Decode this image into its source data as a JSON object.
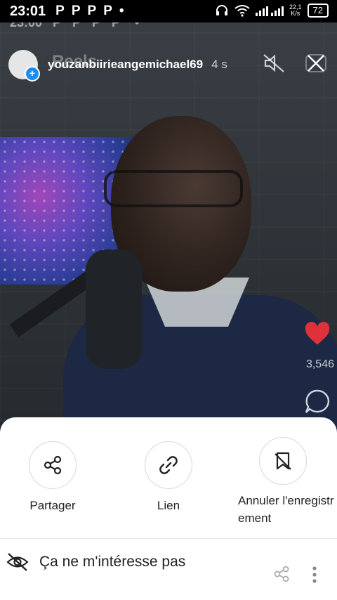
{
  "status_bar": {
    "time": "23:01",
    "notifications": [
      "P",
      "P",
      "P",
      "P",
      "•"
    ],
    "speed_top": "22,1",
    "speed_unit": "K/s",
    "battery": "72"
  },
  "background_ghost": {
    "time": "23:00",
    "notifications": [
      "P",
      "P",
      "P",
      "P",
      "•"
    ],
    "tab_label": "Reels"
  },
  "header": {
    "username": "youzanbiirieangemichael69",
    "age": "4 s"
  },
  "side_actions": {
    "like_count": "3,546"
  },
  "sheet": {
    "actions": [
      {
        "label": "Partager",
        "icon": "share-icon"
      },
      {
        "label": "Lien",
        "icon": "link-icon"
      },
      {
        "label": "Annuler l'enregistrement",
        "icon": "unsave-icon"
      }
    ],
    "not_interested": "Ça ne m'intéresse pas"
  },
  "colors": {
    "like": "#e0313a",
    "accent_blue": "#1d8cf0"
  }
}
